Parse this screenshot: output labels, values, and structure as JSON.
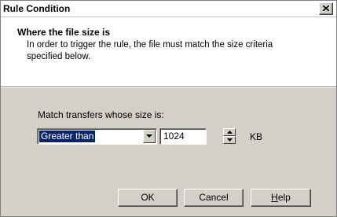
{
  "window": {
    "title": "Rule Condition"
  },
  "header": {
    "title": "Where the file size is",
    "description": "In order to trigger the rule, the file must match the size criteria specified below."
  },
  "form": {
    "match_label": "Match transfers whose size is:",
    "comparison": {
      "selected": "Greater than"
    },
    "size": {
      "value": "1024",
      "unit": "KB"
    }
  },
  "buttons": {
    "ok": "OK",
    "cancel": "Cancel",
    "help": "Help"
  },
  "icons": {
    "close": "close-icon",
    "dropdown": "chevron-down-icon",
    "spin_up": "spin-up-icon",
    "spin_down": "spin-down-icon"
  }
}
